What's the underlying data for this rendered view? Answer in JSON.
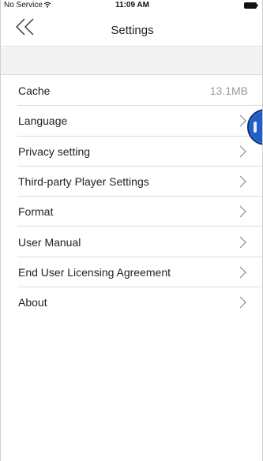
{
  "status_bar": {
    "carrier": "No Service",
    "time": "11:09 AM"
  },
  "nav": {
    "title": "Settings"
  },
  "settings": [
    {
      "label": "Cache",
      "value": "13.1MB",
      "has_chevron": false
    },
    {
      "label": "Language",
      "value": "",
      "has_chevron": true
    },
    {
      "label": "Privacy setting",
      "value": "",
      "has_chevron": true
    },
    {
      "label": "Third-party Player Settings",
      "value": "",
      "has_chevron": true
    },
    {
      "label": "Format",
      "value": "",
      "has_chevron": true
    },
    {
      "label": "User Manual",
      "value": "",
      "has_chevron": true
    },
    {
      "label": "End User Licensing Agreement",
      "value": "",
      "has_chevron": true
    },
    {
      "label": "About",
      "value": "",
      "has_chevron": true
    }
  ],
  "colors": {
    "text": "#222222",
    "secondary_text": "#9a9a9a",
    "divider": "#dcdcdc",
    "spacer_bg": "#f3f3f3",
    "float_button": "#1f5fc6"
  },
  "icons": {
    "back": "double-chevron-left-icon",
    "row": "chevron-right-icon",
    "wifi": "wifi-icon",
    "battery": "battery-icon"
  }
}
